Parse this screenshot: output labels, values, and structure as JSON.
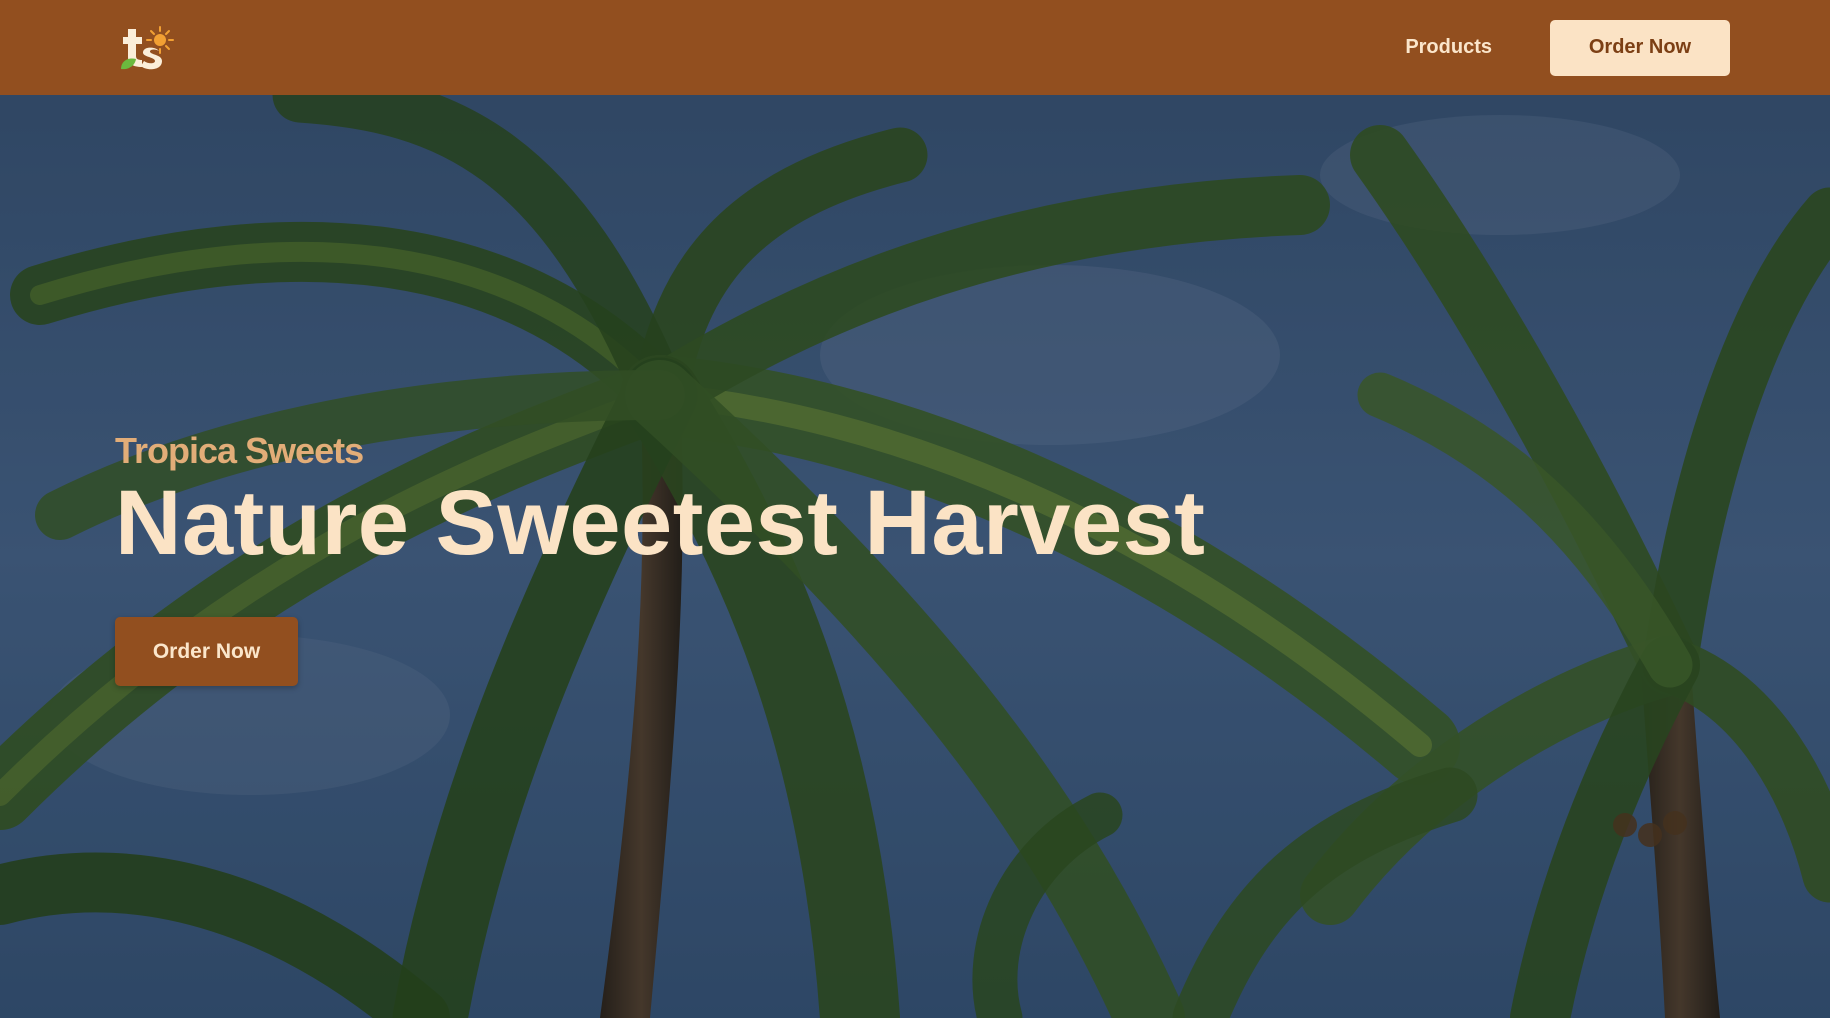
{
  "header": {
    "logo_text": "ts",
    "nav": {
      "products_label": "Products",
      "order_label": "Order Now"
    }
  },
  "hero": {
    "brand": "Tropica Sweets",
    "headline": "Nature Sweetest Harvest",
    "cta_label": "Order Now",
    "background": "palm-trees-photo"
  },
  "colors": {
    "header_bg": "#924f1f",
    "cream": "#fbe3c5",
    "brand_text": "#e2ad78",
    "cta_bg": "#924f1f"
  }
}
